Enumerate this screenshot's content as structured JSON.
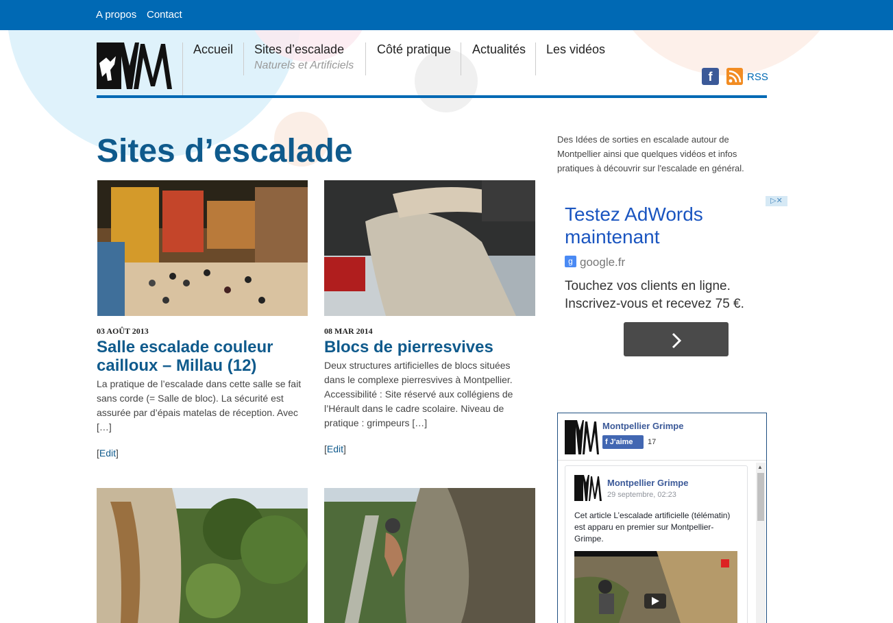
{
  "topbar": {
    "links": [
      "A propos",
      "Contact"
    ]
  },
  "nav": {
    "items": [
      {
        "label": "Accueil",
        "sub": ""
      },
      {
        "label": "Sites d’escalade",
        "sub": "Naturels et Artificiels"
      },
      {
        "label": "Côté pratique",
        "sub": ""
      },
      {
        "label": "Actualités",
        "sub": ""
      },
      {
        "label": "Les vidéos",
        "sub": ""
      }
    ],
    "rss_label": "RSS"
  },
  "page": {
    "title": "Sites d’escalade"
  },
  "posts": [
    {
      "date": "03 AOÛT 2013",
      "title": "Salle escalade couleur cailloux – Millau (12)",
      "excerpt": "La pratique de l’escalade dans cette salle se fait sans corde (= Salle de bloc). La sécurité est assurée par d’épais matelas de réception. Avec […]",
      "edit_label": "Edit"
    },
    {
      "date": "08 MAR 2014",
      "title": "Blocs de pierresvives",
      "excerpt": "Deux structures artificielles de blocs situées dans le complexe pierresvives à Montpellier. Accessibilité : Site réservé aux collégiens de l’Hérault dans le cadre scolaire. Niveau de pratique : grimpeurs […]",
      "edit_label": "Edit"
    }
  ],
  "sidebar": {
    "intro": "Des Idées de sorties en escalade autour de Montpellier ainsi que quelques vidéos et infos pratiques à découvrir sur l'escalade en général.",
    "ad": {
      "headline": "Testez AdWords maintenant",
      "source": "google.fr",
      "body": "Touchez vos clients en ligne. Inscrivez-vous et recevez 75 €."
    },
    "fb_widget": {
      "page_name": "Montpellier Grimpe",
      "like_label": "J'aime",
      "like_count": "17",
      "post_author": "Montpellier Grimpe",
      "post_date": "29 septembre, 02:23",
      "post_text": "Cet article L’escalade artificielle (télématin) est apparu en premier sur Montpellier-Grimpe."
    }
  },
  "colors": {
    "brand_blue": "#0069b4",
    "title_blue": "#0f5a8c",
    "facebook": "#3b5998",
    "rss": "#f28c22"
  }
}
